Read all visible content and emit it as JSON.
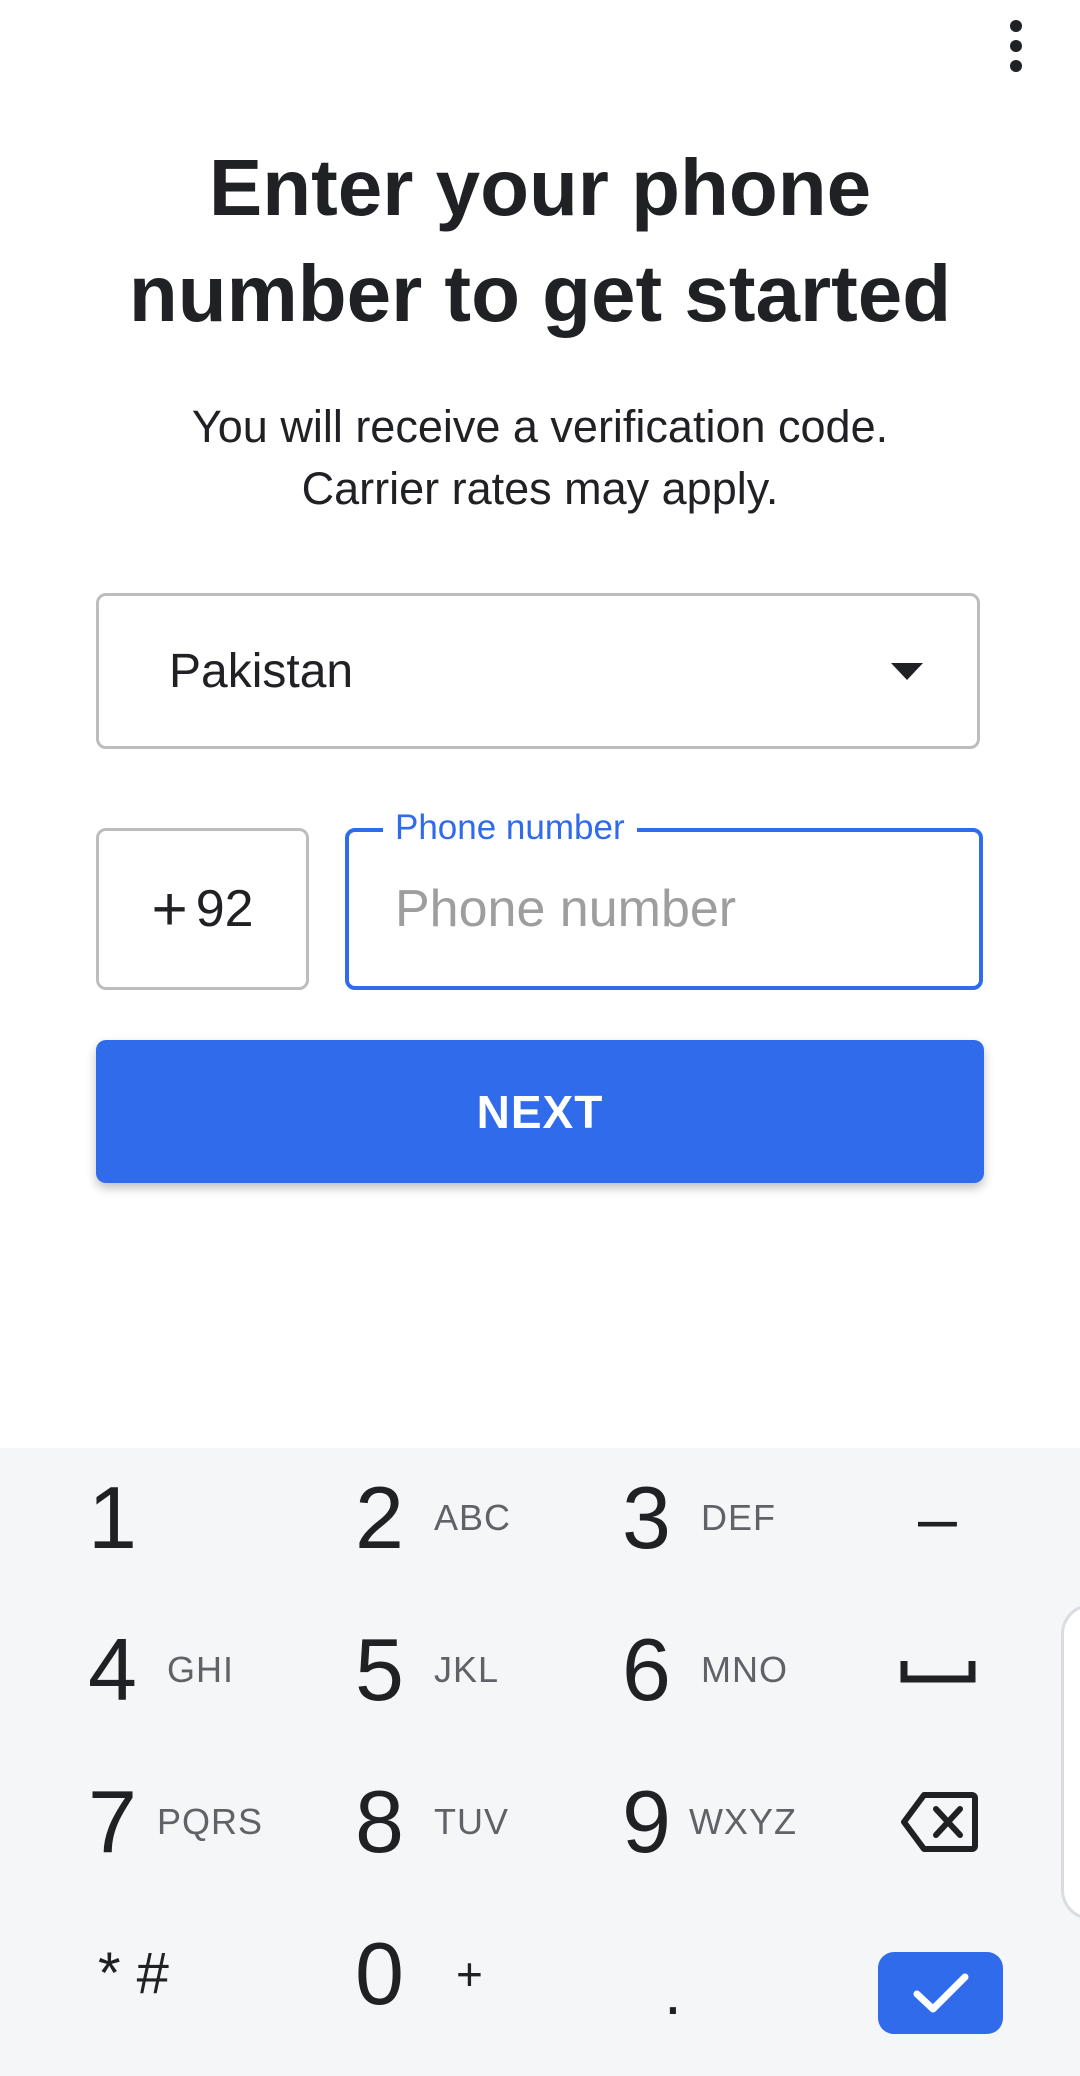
{
  "header": {
    "menu_icon": "more-vert-icon",
    "title": "Enter your phone number to get started",
    "subtitle_line1": "You will receive a verification code.",
    "subtitle_line2": "Carrier rates may apply."
  },
  "form": {
    "country": {
      "selected": "Pakistan",
      "icon": "dropdown-caret-icon"
    },
    "country_code": {
      "plus": "+",
      "value": "92"
    },
    "phone": {
      "label": "Phone number",
      "placeholder": "Phone number",
      "value": ""
    },
    "next_label": "NEXT"
  },
  "keypad": {
    "keys": [
      {
        "num": "1",
        "letters": ""
      },
      {
        "num": "2",
        "letters": "ABC"
      },
      {
        "num": "3",
        "letters": "DEF"
      },
      {
        "num": "–",
        "letters": ""
      },
      {
        "num": "4",
        "letters": "GHI"
      },
      {
        "num": "5",
        "letters": "JKL"
      },
      {
        "num": "6",
        "letters": "MNO"
      },
      {
        "num": "space",
        "letters": ""
      },
      {
        "num": "7",
        "letters": "PQRS"
      },
      {
        "num": "8",
        "letters": "TUV"
      },
      {
        "num": "9",
        "letters": "WXYZ"
      },
      {
        "num": "backspace",
        "letters": ""
      },
      {
        "num": "* #",
        "letters": ""
      },
      {
        "num": "0",
        "letters": "+"
      },
      {
        "num": ".",
        "letters": ""
      },
      {
        "num": "done",
        "letters": ""
      }
    ]
  },
  "colors": {
    "accent": "#2f6bea",
    "keypad_bg": "#f5f6f8",
    "text": "#202124"
  }
}
